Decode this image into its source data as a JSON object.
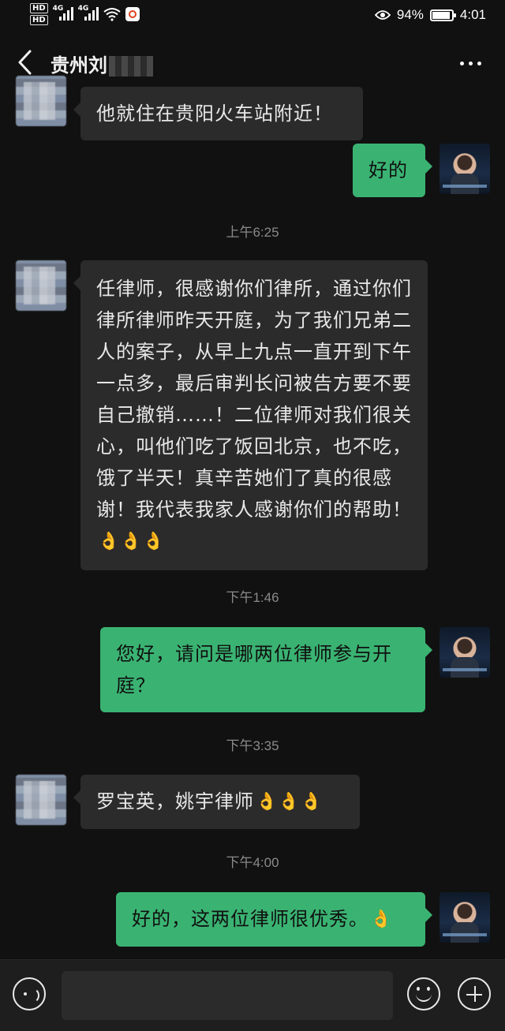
{
  "status_bar": {
    "hd1": "HD",
    "hd2": "HD",
    "net1": "4G",
    "net2": "4G",
    "battery_text": "94%",
    "battery_level": 0.94,
    "time": "4:01"
  },
  "header": {
    "title": "贵州刘"
  },
  "messages": [
    {
      "side": "other",
      "text": "他就住在贵阳火车站附近！"
    },
    {
      "side": "self",
      "text": "好的"
    },
    {
      "timestamp": "上午6:25"
    },
    {
      "side": "other",
      "text": "任律师，很感谢你们律所，通过你们律所律师昨天开庭，为了我们兄弟二人的案子，从早上九点一直开到下午一点多，最后审判长问被告方要不要自己撤销……！二位律师对我们很关心，叫他们吃了饭回北京，也不吃，饿了半天！真辛苦她们了真的很感谢！我代表我家人感谢你们的帮助！",
      "emoji": "👌👌👌"
    },
    {
      "timestamp": "下午1:46"
    },
    {
      "side": "self",
      "text": "您好，请问是哪两位律师参与开庭？"
    },
    {
      "timestamp": "下午3:35"
    },
    {
      "side": "other",
      "text": "罗宝英，姚宇律师",
      "emoji": "👌👌👌"
    },
    {
      "timestamp": "下午4:00"
    },
    {
      "side": "self",
      "text": "好的，这两位律师很优秀。",
      "emoji": "👌"
    }
  ],
  "input_bar": {
    "voice_icon": "voice-icon",
    "emoji_icon": "emoji-icon",
    "plus_icon": "plus-icon"
  },
  "colors": {
    "background": "#111111",
    "bubble_other": "#2b2b2b",
    "bubble_self": "#3ab372"
  }
}
